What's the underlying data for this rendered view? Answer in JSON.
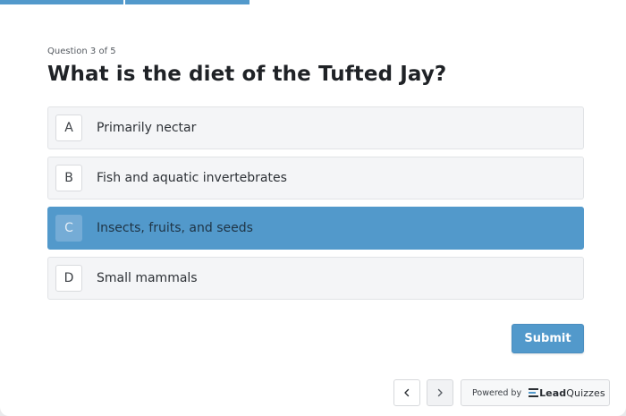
{
  "progress": {
    "current": 3,
    "total": 5,
    "accent": "#5299cb"
  },
  "question": {
    "counter": "Question 3 of 5",
    "title": "What is the diet of the Tufted Jay?"
  },
  "answers": [
    {
      "letter": "A",
      "text": "Primarily nectar",
      "selected": false
    },
    {
      "letter": "B",
      "text": "Fish and aquatic invertebrates",
      "selected": false
    },
    {
      "letter": "C",
      "text": "Insects, fruits, and seeds",
      "selected": true
    },
    {
      "letter": "D",
      "text": "Small mammals",
      "selected": false
    }
  ],
  "submit_label": "Submit",
  "nav": {
    "prev_icon": "chevron-left-icon",
    "next_icon": "chevron-right-icon"
  },
  "powered": {
    "label": "Powered by",
    "brand_bold": "Lead",
    "brand_rest": "Quizzes"
  }
}
